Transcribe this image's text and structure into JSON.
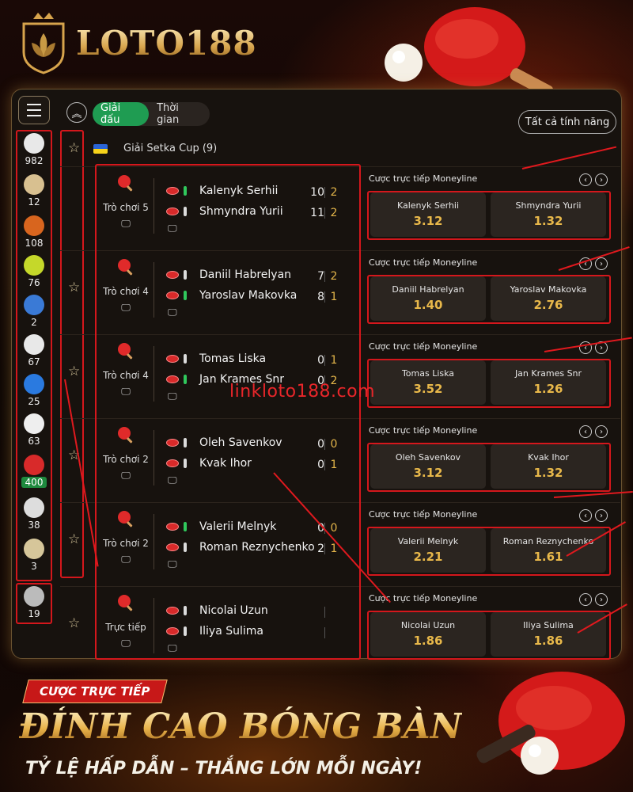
{
  "brand": {
    "name": "LOTO188"
  },
  "toolbar": {
    "tabs": [
      {
        "label": "Giải đấu"
      },
      {
        "label": "Thời gian"
      }
    ],
    "all_features": "Tất cả tính năng"
  },
  "sports": [
    {
      "icon": "soccer-ball-icon",
      "count": "982"
    },
    {
      "icon": "volleyball-v-icon",
      "count": "12"
    },
    {
      "icon": "basketball-icon",
      "count": "108"
    },
    {
      "icon": "tennis-ball-icon",
      "count": "76"
    },
    {
      "icon": "sneaker-icon",
      "count": "2"
    },
    {
      "icon": "gamepad-icon",
      "count": "67"
    },
    {
      "icon": "volleyball-icon",
      "count": "25"
    },
    {
      "icon": "baseball-icon",
      "count": "63"
    },
    {
      "icon": "table-tennis-icon",
      "count": "400",
      "active": true
    },
    {
      "icon": "badminton-icon",
      "count": "38"
    },
    {
      "icon": "billiards-icon",
      "count": "3"
    },
    {
      "icon": "more-sports-icon",
      "count": "19"
    }
  ],
  "league": {
    "name": "Giải Setka Cup (9)",
    "flag_colors": [
      "#2a64d6",
      "#f7d31a"
    ]
  },
  "market_label": "Cược trực tiếp Moneyline",
  "matches": [
    {
      "status": "Trò chơi 5",
      "p1": "Kalenyk Serhii",
      "p2": "Shmyndra Yurii",
      "g1": "10",
      "g2": "11",
      "s1": "2",
      "s2": "2",
      "serve": 1,
      "o1": "3.12",
      "o2": "1.32"
    },
    {
      "status": "Trò chơi 4",
      "p1": "Daniil Habrelyan",
      "p2": "Yaroslav Makovka",
      "g1": "7",
      "g2": "8",
      "s1": "2",
      "s2": "1",
      "serve": 2,
      "o1": "1.40",
      "o2": "2.76"
    },
    {
      "status": "Trò chơi 4",
      "p1": "Tomas Liska",
      "p2": "Jan Krames Snr",
      "g1": "0",
      "g2": "0",
      "s1": "1",
      "s2": "2",
      "serve": 2,
      "o1": "3.52",
      "o2": "1.26"
    },
    {
      "status": "Trò chơi 2",
      "p1": "Oleh Savenkov",
      "p2": "Kvak Ihor",
      "g1": "0",
      "g2": "0",
      "s1": "0",
      "s2": "1",
      "serve": 0,
      "o1": "3.12",
      "o2": "1.32"
    },
    {
      "status": "Trò chơi 2",
      "p1": "Valerii Melnyk",
      "p2": "Roman Reznychenko",
      "g1": "0",
      "g2": "2",
      "s1": "0",
      "s2": "1",
      "serve": 1,
      "o1": "2.21",
      "o2": "1.61"
    },
    {
      "status": "Trực tiếp",
      "p1": "Nicolai Uzun",
      "p2": "Iliya Sulima",
      "g1": "",
      "g2": "",
      "s1": "",
      "s2": "",
      "serve": 0,
      "o1": "1.86",
      "o2": "1.86"
    }
  ],
  "watermark": "linkloto188.com",
  "promo": {
    "badge": "CƯỢC TRỰC TIẾP",
    "title": "ĐỈNH CAO BÓNG BÀN",
    "subtitle": "TỶ LỆ HẤP DẪN – THẮNG LỚN MỖI NGÀY!"
  },
  "colors": {
    "accent_green": "#1f9c52",
    "odds_gold": "#e8b84a",
    "highlight_red": "#d4171c"
  }
}
